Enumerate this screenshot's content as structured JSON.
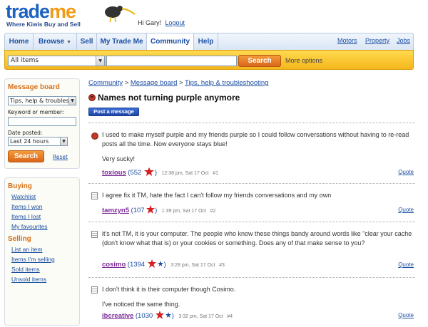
{
  "header": {
    "logo_trade": "trade",
    "logo_me": "me",
    "tagline": "Where Kiwis Buy and Sell",
    "greeting": "Hi Gary!",
    "logout": "Logout"
  },
  "nav": {
    "tabs": [
      "Home",
      "Browse",
      "Sell",
      "My Trade Me",
      "Community",
      "Help"
    ],
    "active_tab": "Community",
    "right_links": [
      "Motors",
      "Property",
      "Jobs"
    ]
  },
  "search": {
    "category": "All items",
    "button": "Search",
    "more_options": "More options"
  },
  "sidebar": {
    "message_board": {
      "title": "Message board",
      "board_select": "Tips, help & troubleshooting",
      "keyword_label": "Keyword or member:",
      "date_label": "Date posted:",
      "date_select": "Last 24 hours",
      "search_button": "Search",
      "reset": "Reset"
    },
    "buying": {
      "title": "Buying",
      "links": [
        "Watchlist",
        "Items I won",
        "Items I lost",
        "My favourites"
      ]
    },
    "selling": {
      "title": "Selling",
      "links": [
        "List an item",
        "Items I'm selling",
        "Sold items",
        "Unsold items"
      ]
    }
  },
  "breadcrumb": [
    "Community",
    "Message board",
    "Tips, help & troubleshooting"
  ],
  "breadcrumb_sep": ">",
  "thread": {
    "title": "Names not turning purple anymore",
    "post_button": "Post a message"
  },
  "posts": [
    {
      "icon": "red-face-icon",
      "paragraphs": [
        "I used to make myself purple and my friends purple so I could follow conversations without having to re-read posts all the time. Now everyone stays blue!",
        "Very sucky!"
      ],
      "author": "toxious",
      "feedback": "(552",
      "time": "12:38 pm, Sat 17 Oct",
      "number": "#1",
      "quote": "Quote"
    },
    {
      "icon": "document-icon",
      "paragraphs": [
        "I agree fix it TM, hate the fact I can't follow my friends conversations and my own"
      ],
      "author": "tamzyn5",
      "feedback": "(107",
      "time": "1:39 pm, Sat 17 Oct",
      "number": "#2",
      "quote": "Quote"
    },
    {
      "icon": "document-icon",
      "paragraphs": [
        "it's not TM, it is your computer. The people who know these things bandy around words like \"clear your cache (don't know what that is) or your cookies or something. Does any of that make sense to you?"
      ],
      "author": "cosimo",
      "feedback": "(1394",
      "time": "3:28 pm, Sat 17 Oct",
      "number": "#3",
      "quote": "Quote"
    },
    {
      "icon": "document-icon",
      "paragraphs": [
        "I don't think it is their computer though Cosimo.",
        "I've noticed the same thing."
      ],
      "author": "ibcreative",
      "feedback": "(1030",
      "time": "3:32 pm, Sat 17 Oct",
      "number": "#4",
      "quote": "Quote"
    }
  ],
  "colors": {
    "brand_blue": "#1b62c2",
    "brand_orange": "#f19a14",
    "search_bar": "#f5b71b",
    "button_orange": "#d9661a",
    "author_purple": "#7b2a96"
  }
}
